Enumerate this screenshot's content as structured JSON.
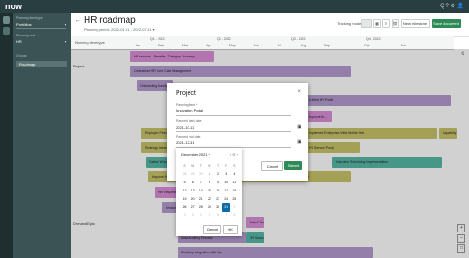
{
  "app": {
    "logo": "now",
    "top_icons": "Q  ?  ⚙  👤"
  },
  "filters": {
    "label1": "Planning item type",
    "value1": "Portfolios",
    "label2": "Planning unit",
    "value2": "HR",
    "group_label": "Groups",
    "group_item": "Roadmap"
  },
  "header": {
    "title": "HR roadmap",
    "period": "Planning period: 2022-01-01 - 2022-07-31 ▾",
    "tracking_label": "Tracking mode",
    "new_milestone": "New milestone",
    "save": "Save document ▾"
  },
  "grid": {
    "row_header": "Planning item type",
    "columns": [
      {
        "top": "Q1 - 2022",
        "sub": [
          "Jan",
          "Feb",
          "Mar"
        ]
      },
      {
        "top": "Q2 - 2022",
        "sub": [
          "Apr",
          "May",
          "Jun"
        ]
      },
      {
        "top": "Q3 - 2022",
        "sub": [
          "Jul",
          "Aug",
          "Sep"
        ]
      },
      {
        "top": "Q4 - 2022",
        "sub": [
          "Oct",
          "Nov"
        ]
      }
    ],
    "rows": [
      "Project",
      "Demand Epic"
    ],
    "bars": [
      "HR services - Benefits - Category Journeys",
      "Centralized HR Core Case Management",
      "Onboarding Bundle Enterprise",
      "Unified HR Portal",
      "Improve UI...",
      "Employee Feedback",
      "Implement Enterprise-Wide Mobile Hub",
      "Capability Workforce Enhancements",
      "Redesign Intranet",
      "Gather Windows Prioritization Solution",
      "HR Service Portal",
      "Interview Scheduling Implementation",
      "Improve HR onboarding process",
      "Employee on-boarding process improvement",
      "HR Request Workflows",
      "Vendor Management",
      "Data Privacy Implementation",
      "HR Service Centralization",
      "Data Auditing Process",
      "Workday integration with Sys",
      "HR Service..."
    ]
  },
  "modal": {
    "title": "Project",
    "close": "×",
    "name_label": "Planning item *",
    "name_value": "Innovation Portal",
    "start_label": "Planned start date",
    "start_value": "2021-10-11",
    "end_label": "Planned end date",
    "end_value": "2021-12-31",
    "cancel": "Cancel",
    "submit": "Submit"
  },
  "calendar": {
    "month": "December",
    "year": "2021 ▾",
    "nav": "‹ ⊙ ›",
    "dow": [
      "S",
      "M",
      "T",
      "W",
      "T",
      "F",
      "S"
    ],
    "weeks": [
      [
        "28",
        "29",
        "30",
        "1",
        "2",
        "3",
        "4"
      ],
      [
        "5",
        "6",
        "7",
        "8",
        "9",
        "10",
        "11"
      ],
      [
        "12",
        "13",
        "14",
        "15",
        "16",
        "17",
        "18"
      ],
      [
        "19",
        "20",
        "21",
        "22",
        "23",
        "24",
        "25"
      ],
      [
        "26",
        "27",
        "28",
        "29",
        "30",
        "31",
        "1"
      ],
      [
        "2",
        "3",
        "4",
        "5",
        "6",
        "7",
        "8"
      ]
    ],
    "selected": "31",
    "cancel": "Cancel",
    "ok": "OK"
  },
  "colors": {
    "topbar": "#293e40",
    "bar_purple": "#b59bd1",
    "bar_olive": "#c9c46a",
    "bar_teal": "#57b9a8",
    "bar_pink": "#d98fd6",
    "selected": "#0b6aa8"
  }
}
